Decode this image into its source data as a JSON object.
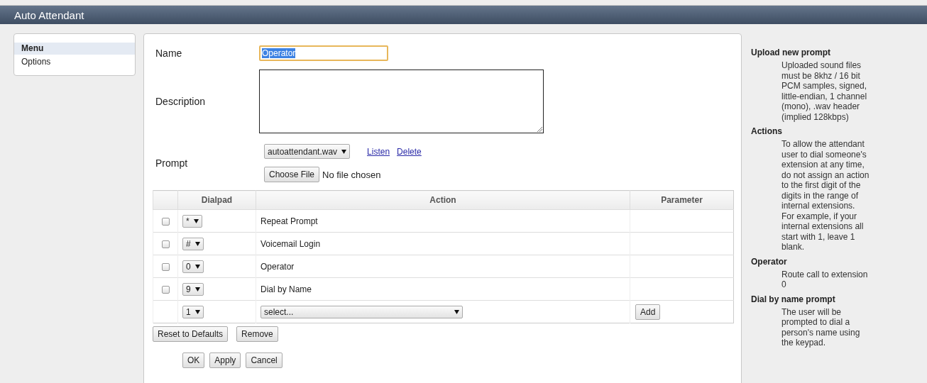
{
  "window": {
    "title": "Auto Attendant"
  },
  "sidebar": {
    "items": [
      {
        "label": "Menu",
        "selected": true
      },
      {
        "label": "Options",
        "selected": false
      }
    ]
  },
  "form": {
    "name": {
      "label": "Name",
      "value": "Operator",
      "focused": true,
      "text_selected": true
    },
    "description": {
      "label": "Description"
    },
    "prompt": {
      "label": "Prompt",
      "file": "autoattendant.wav",
      "links": [
        "Listen",
        "Delete"
      ],
      "choose_button": "Choose File",
      "file_status": "No file chosen"
    }
  },
  "table": {
    "columns": [
      "Dialpad",
      "Action",
      "Parameter"
    ],
    "rows": [
      {
        "checked": false,
        "key": "*",
        "action": "Repeat Prompt"
      },
      {
        "checked": false,
        "key": "#",
        "action": "Voicemail Login"
      },
      {
        "checked": false,
        "key": "0",
        "action": "Operator"
      },
      {
        "checked": false,
        "key": "9",
        "action": "Dial by Name"
      }
    ],
    "new_row": {
      "key": "1",
      "action": "select...",
      "button": "Add"
    }
  },
  "table_buttons": [
    "Reset to Defaults",
    "Remove"
  ],
  "buttons": [
    "OK",
    "Apply",
    "Cancel"
  ],
  "help": [
    {
      "heading": "Upload new prompt",
      "text": "Uploaded sound files must be 8khz / 16 bit PCM samples, signed, little-endian, 1 channel (mono), .wav header (implied 128kbps)"
    },
    {
      "heading": "Actions",
      "text": "To allow the attendant user to dial someone's extension at any time, do not assign an action to the first digit of the digits in the range of internal extensions. For example, if your internal extensions all start with 1, leave 1 blank."
    },
    {
      "heading": "Operator",
      "text": "Route call to extension 0"
    },
    {
      "heading": "Dial by name prompt",
      "text": "The user will be prompted to dial a person's name using the keypad."
    }
  ]
}
